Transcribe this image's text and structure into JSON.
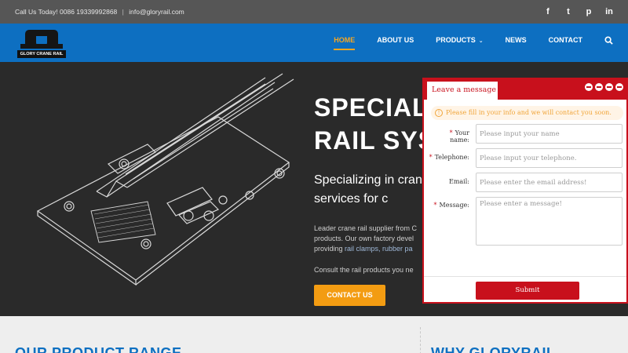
{
  "topbar": {
    "phone_text": "Call Us Today! 0086 19339992868",
    "separator": "|",
    "email": "info@gloryrail.com",
    "social": [
      "f",
      "t",
      "p",
      "in"
    ]
  },
  "nav": {
    "logo_text": "GLORY CRANE RAIL",
    "items": [
      {
        "label": "HOME"
      },
      {
        "label": "ABOUT US"
      },
      {
        "label": "PRODUCTS"
      },
      {
        "label": "NEWS"
      },
      {
        "label": "CONTACT"
      }
    ],
    "products_caret": "⌄",
    "active_color": "#f5a623"
  },
  "hero": {
    "title_line1": "SPECIALI",
    "title_line2": "RAIL SYS",
    "subtitle": "Specializing in crane supply services for c",
    "para_a": "Leader crane rail supplier from C products. Our own factory devel providing ",
    "para_link": "rail clamps, rubber pa",
    "consult": "Consult the rail products you ne",
    "cta_label": "CONTACT US"
  },
  "lower": {
    "left_heading": "OUR PRODUCT RANGE",
    "right_heading": "WHY GLORYRAIL"
  },
  "widget": {
    "tab_label": "Leave a message",
    "notice": "Please fill in your info and we will contact you soon.",
    "fields": {
      "name_label": "Your name:",
      "name_placeholder": "Please input your name",
      "phone_label": "Telephone:",
      "phone_placeholder": "Please input your telephone.",
      "email_label": "Email:",
      "email_placeholder": "Please enter the email address!",
      "message_label": "Message:",
      "message_placeholder": "Please enter a message!"
    },
    "required_mark": "*",
    "submit_label": "Submit",
    "accent_color": "#c8101c"
  }
}
